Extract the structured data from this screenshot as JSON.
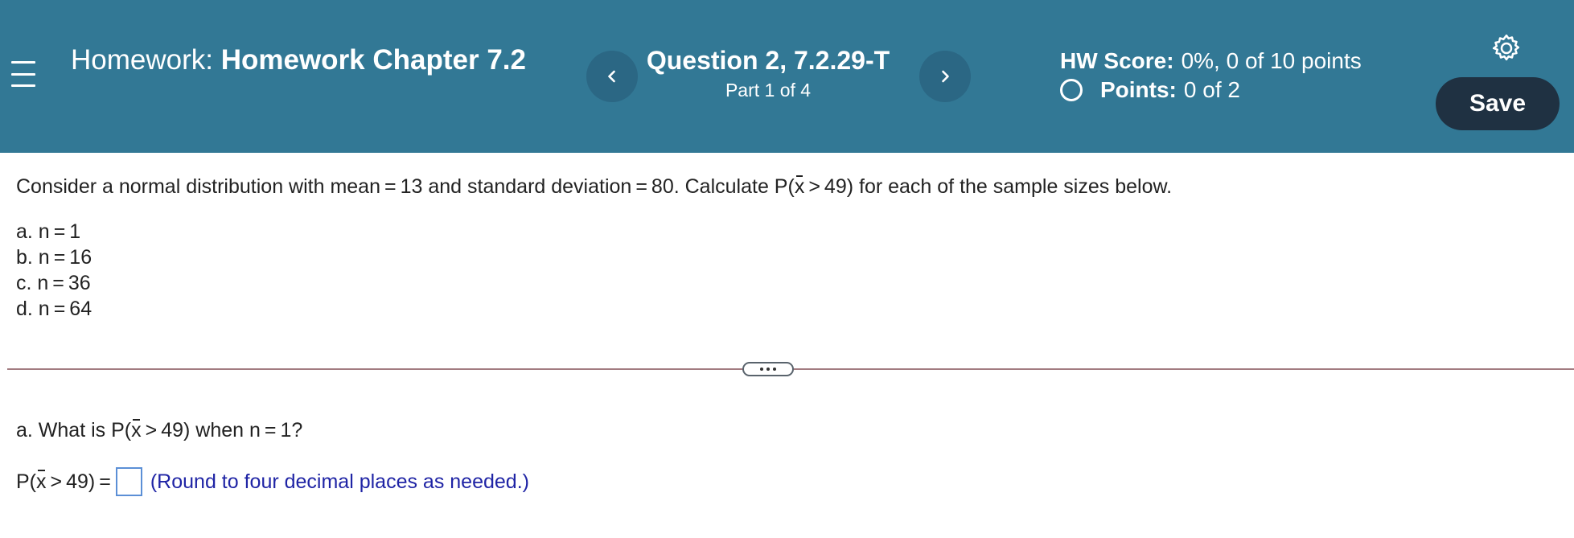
{
  "header": {
    "title_prefix": "Homework:",
    "title_name": "Homework Chapter 7.2",
    "question_title": "Question 2, 7.2.29-T",
    "question_part": "Part 1 of 4",
    "hw_score_label": "HW Score:",
    "hw_score_value": "0%, 0 of 10 points",
    "points_label": "Points:",
    "points_value": "0 of 2",
    "save_label": "Save",
    "prev_glyph": "‹",
    "next_glyph": "›"
  },
  "problem": {
    "intro_before": "Consider a normal distribution with mean = 13 and standard deviation = 80. Calculate P(",
    "intro_var": "x",
    "intro_after": " > 49) for each of the sample sizes below.",
    "parts": [
      "a. n = 1",
      "b. n = 16",
      "c. n = 36",
      "d. n = 64"
    ]
  },
  "question_a": {
    "prompt_before": "a. What is P(",
    "prompt_var": "x",
    "prompt_after": " > 49) when n = 1?",
    "answer_before": "P(",
    "answer_var": "x",
    "answer_after": " > 49) =",
    "answer_value": "",
    "hint": "(Round to four decimal places as needed.)"
  },
  "icons": {
    "menu": "hamburger-icon",
    "prev": "chevron-left-icon",
    "next": "chevron-right-icon",
    "settings": "gear-icon",
    "radio": "radio-empty-icon",
    "more": "ellipsis-icon"
  },
  "colors": {
    "header_bg": "#327895",
    "save_bg": "#1f3142",
    "hint_text": "#1f24a5",
    "input_border": "#5b8fd6"
  }
}
